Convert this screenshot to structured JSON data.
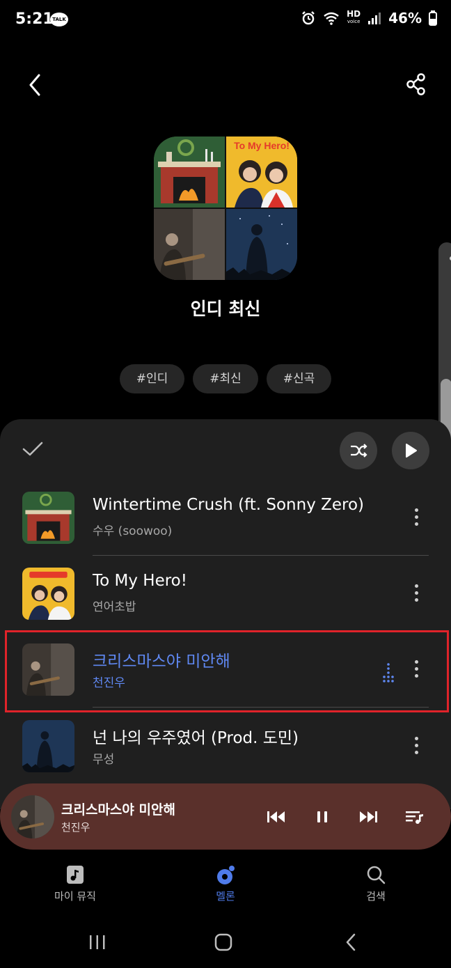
{
  "status_bar": {
    "time": "5:21",
    "talk_badge": "TALK",
    "hd_label": "HD",
    "hd_sub": "voice",
    "battery": "46%"
  },
  "playlist": {
    "title": "인디 최신",
    "tags": [
      "#인디",
      "#최신",
      "#신곡"
    ]
  },
  "tracks": [
    {
      "title": "Wintertime Crush (ft. Sonny Zero)",
      "artist": "수우 (soowoo)",
      "playing": false,
      "cover": "fireplace-cover"
    },
    {
      "title": "To My Hero!",
      "artist": "연어초밥",
      "playing": false,
      "cover": "hero-cover",
      "cover_text": "To My Hero!"
    },
    {
      "title": "크리스마스야 미안해",
      "artist": "천진우",
      "playing": true,
      "cover": "guitar-cover"
    },
    {
      "title": "넌 나의 우주였어 (Prod. 도민)",
      "artist": "무성",
      "playing": false,
      "cover": "night-cover"
    }
  ],
  "now_playing": {
    "title": "크리스마스야 미안해",
    "artist": "천진우"
  },
  "bottom_nav": {
    "items": [
      {
        "label": "마이 뮤직",
        "icon": "music-note-icon",
        "active": false
      },
      {
        "label": "멜론",
        "icon": "melon-icon",
        "active": true
      },
      {
        "label": "검색",
        "icon": "search-icon",
        "active": false
      }
    ]
  },
  "colors": {
    "accent_blue": "#5f88f2",
    "mini_player_bg": "#5a302b",
    "highlight_red": "#e0232a",
    "panel_bg": "#1f1f1f"
  }
}
